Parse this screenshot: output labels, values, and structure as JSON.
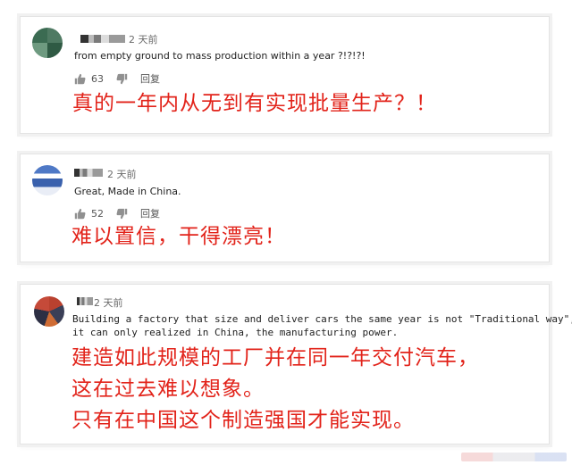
{
  "comments": [
    {
      "time": "2 天前",
      "text": "from empty ground to mass production within a year ?!?!?!",
      "likes": "63",
      "reply": "回复",
      "translation": "真的一年内从无到有实现批量生产？！"
    },
    {
      "time": "2 天前",
      "text": "Great, Made in China.",
      "likes": "52",
      "reply": "回复",
      "translation": "难以置信，干得漂亮！"
    },
    {
      "time": "2 天前",
      "text_line1": "Building a factory that size and deliver cars the same year is not \"Traditional way\",",
      "text_line2": "it can only realized in China, the manufacturing power.",
      "translation_lines": [
        "建造如此规模的工厂并在同一年交付汽车，",
        "这在过去难以想象。",
        "只有在中国这个制造强国才能实现。"
      ]
    }
  ],
  "colors": {
    "translation": "#e2231a",
    "card_border": "#e4e4e4"
  },
  "icons": [
    "avatar",
    "thumbs-up-icon",
    "thumbs-down-icon"
  ]
}
